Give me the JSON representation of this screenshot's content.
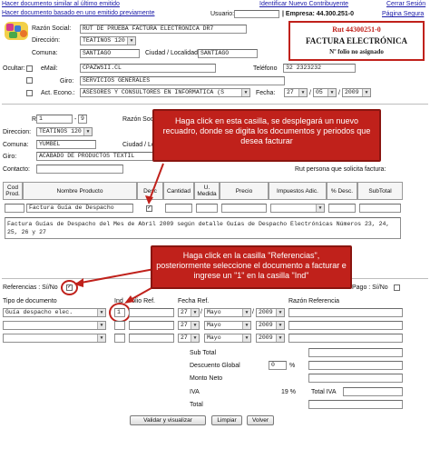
{
  "top_links": {
    "similar": "Hacer documento similar al último emitido",
    "based": "Hacer documento basado en uno emitido previamente",
    "identify": "Identificar Nuevo Contribuyente",
    "close": "Cerrar Sesión",
    "user_label": "Usuario:",
    "company": "| Empresa: 44.300.251-0",
    "safe_page": "Página Segura"
  },
  "emisor": {
    "razon_label": "Razón Social:",
    "razon": "RUT DE PRUEBA FACTURA ELECTRONICA DR7",
    "direccion_label": "Dirección:",
    "direccion": "TEATINOS 120",
    "comuna_label": "Comuna:",
    "comuna": "SANTIAGO",
    "ciudad_label": "Ciudad / Localidad:",
    "ciudad": "SANTIAGO",
    "ocultar_label": "Ocultar:",
    "email_label": "eMail:",
    "email": "CPAZWSII.CL",
    "telefono_label": "Teléfono",
    "telefono": "32 2323232",
    "giro_label": "Giro:",
    "giro": "SERVICIOS GENERALES",
    "actecon_label": "Act. Econo.:",
    "actecon": "ASESORES Y CONSULTORES EN INFORMATICA (S",
    "fecha_label": "Fecha:",
    "fecha_dia": "27",
    "fecha_mes": "05",
    "fecha_anio": "2009"
  },
  "doc_box": {
    "rut": "Rut 44300251-0",
    "tipo": "FACTURA ELECTRÓNICA",
    "folio": "Nº folio no asignado"
  },
  "receptor": {
    "rut_label": "Rut:",
    "rut": "1",
    "dv": "9",
    "razon_label": "Razón Soci",
    "direccion_label": "Direccion:",
    "direccion": "TEATINOS 120",
    "comuna_label": "Comuna:",
    "comuna": "YUMBEL",
    "ciudad_label": "Ciudad / Lo",
    "giro_label": "Giro:",
    "giro": "ACABADO DE PRODUCTOS TEXTIL",
    "contacto_label": "Contacto:",
    "solicita_label": "Rut persona que solicita factura:"
  },
  "products": {
    "headers": [
      "Cod Prod.",
      "Nombre Producto",
      "Desc",
      "Cantidad",
      "U. Medida",
      "Precio",
      "Impuestos Adic.",
      "% Desc.",
      "SubTotal"
    ],
    "row_name": "Factura Guía de Despacho",
    "row_check": "✓",
    "description": "Factura Guías de Despacho del Mes de Abril 2009 según detalle Guías de Despacho Electrónicas Números 23, 24, 25, 26 y 27"
  },
  "referencias": {
    "label": "Referencias : Sí/No",
    "check": "✓",
    "pago_label": "Pago : Sí/No",
    "col_tipo": "Tipo de documento",
    "col_ind": "Ind",
    "col_folio": "Folio Ref.",
    "col_fecha": "Fecha Ref.",
    "col_razon": "Razón Referencia",
    "row_tipo": "Guía despacho elec.",
    "row_ind": "1",
    "fecha_dia": "27",
    "fecha_mes": "Mayo",
    "fecha_anio": "2009"
  },
  "totals": {
    "subtotal": "Sub Total",
    "descuento": "Descuento Global",
    "descuento_pct": "0",
    "pct_sign": "%",
    "monto_neto": "Monto Neto",
    "iva": "IVA",
    "iva_pct": "19 %",
    "total_iva": "Total IVA",
    "total": "Total"
  },
  "buttons": {
    "validar": "Validar y visualizar",
    "limpiar": "Limpiar",
    "volver": "Volver"
  },
  "callouts": {
    "top": "Haga click en esta casilla, se desplegará un nuevo recuadro, donde se digita los documentos y periodos que desea facturar",
    "bottom": "Haga click en la casilla \"Referencias\", posteriormente seleccione el documento a facturar e ingrese un \"1\" en la casilla \"Ind\""
  },
  "colors": {
    "callout": "#c0211b",
    "doc_box_border": "#c0211b",
    "link": "#1a1aa8"
  }
}
